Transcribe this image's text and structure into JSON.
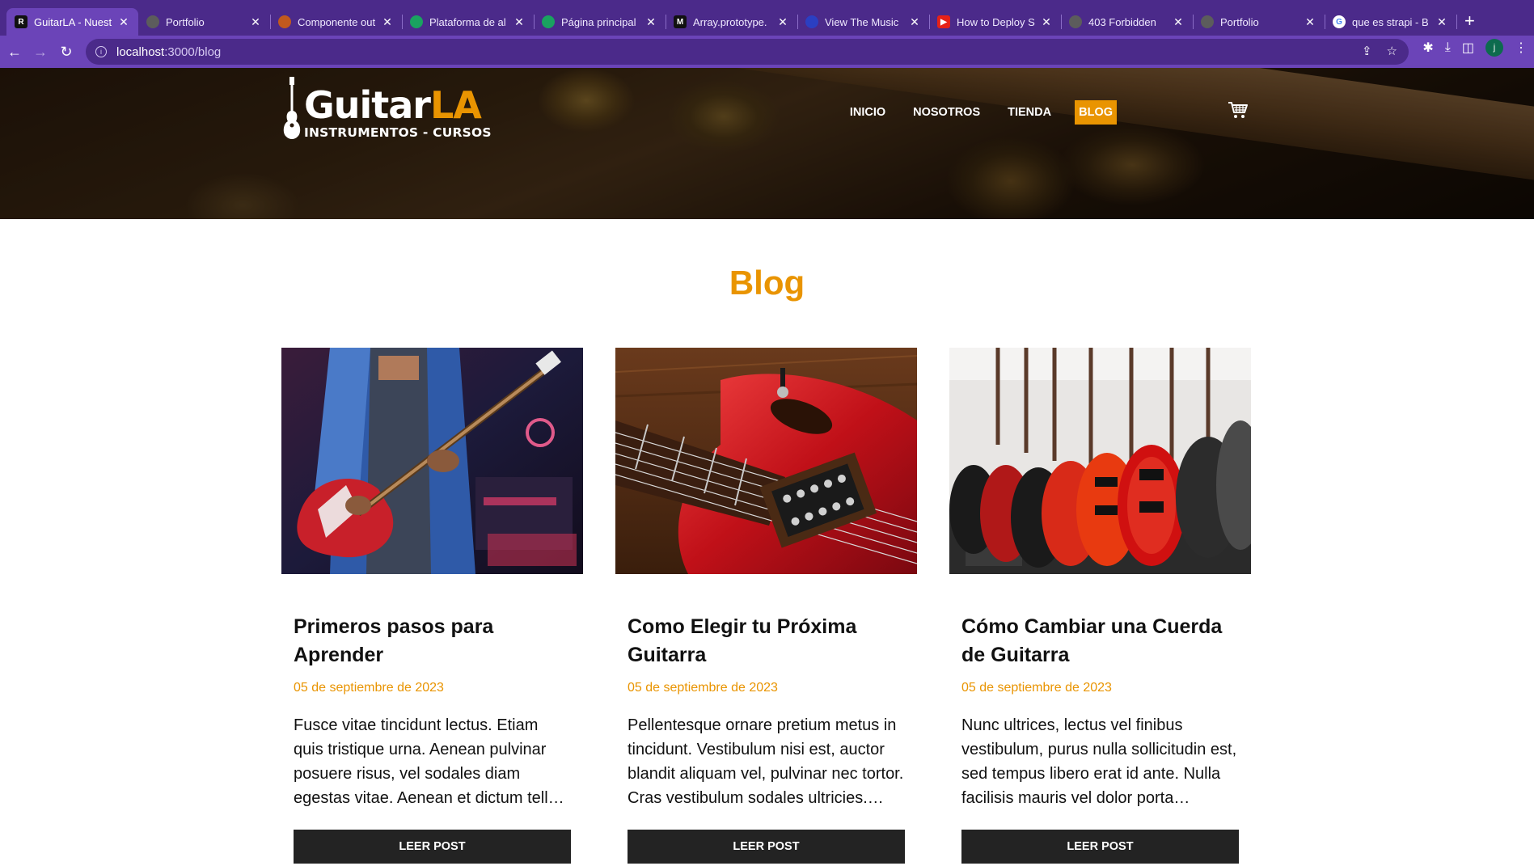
{
  "browser": {
    "tabs": [
      {
        "title": "GuitarLA - Nuest",
        "favicon": "R",
        "favicon_color": "#111111",
        "active": true
      },
      {
        "title": "Portfolio",
        "favicon": "",
        "favicon_color": "#5c5c5c",
        "active": false
      },
      {
        "title": "Componente out",
        "favicon": "",
        "favicon_color": "#c2591d",
        "active": false
      },
      {
        "title": "Plataforma de al",
        "favicon": "",
        "favicon_color": "#1aa260",
        "active": false
      },
      {
        "title": "Página principal",
        "favicon": "",
        "favicon_color": "#1aa260",
        "active": false
      },
      {
        "title": "Array.prototype.",
        "favicon": "M",
        "favicon_color": "#111111",
        "active": false
      },
      {
        "title": "View The Music",
        "favicon": "",
        "favicon_color": "#2b3fc2",
        "active": false
      },
      {
        "title": "How to Deploy S",
        "favicon": "▶",
        "favicon_color": "#e62117",
        "active": false
      },
      {
        "title": "403 Forbidden",
        "favicon": "",
        "favicon_color": "#5c5c5c",
        "active": false
      },
      {
        "title": "Portfolio",
        "favicon": "",
        "favicon_color": "#5c5c5c",
        "active": false
      },
      {
        "title": "que es strapi - B",
        "favicon": "G",
        "favicon_color": "#ffffff",
        "active": false
      }
    ],
    "new_tab_label": "+",
    "url_host": "localhost",
    "url_path": ":3000/blog",
    "profile_initial": "j"
  },
  "site": {
    "logo": {
      "main": "Guitar",
      "accent": "LA",
      "sub": "INSTRUMENTOS - CURSOS"
    },
    "nav": [
      {
        "label": "Inicio",
        "active": false
      },
      {
        "label": "Nosotros",
        "active": false
      },
      {
        "label": "Tienda",
        "active": false
      },
      {
        "label": "Blog",
        "active": true
      }
    ],
    "accent_color": "#e99401"
  },
  "page": {
    "title": "Blog"
  },
  "posts": [
    {
      "title": "Primeros pasos para Aprender",
      "date": "05 de septiembre de 2023",
      "excerpt": "Fusce vitae tincidunt lectus. Etiam quis tristique urna. Aenean pulvinar posuere risus, vel sodales diam egestas vitae. Aenean et dictum tell…",
      "button": "Leer Post",
      "image": "guitarist-blue-shirt"
    },
    {
      "title": "Como Elegir tu Próxima Guitarra",
      "date": "05 de septiembre de 2023",
      "excerpt": "Pellentesque ornare pretium metus in tincidunt. Vestibulum nisi est, auctor blandit aliquam vel, pulvinar nec tortor. Cras vestibulum sodales ultricies.…",
      "button": "Leer Post",
      "image": "red-guitar-closeup"
    },
    {
      "title": "Cómo Cambiar una Cuerda de Guitarra",
      "date": "05 de septiembre de 2023",
      "excerpt": "Nunc ultrices, lectus vel finibus vestibulum, purus nulla sollicitudin est, sed tempus libero erat id ante. Nulla facilisis mauris vel dolor porta…",
      "button": "Leer Post",
      "image": "guitar-store-rack"
    }
  ]
}
